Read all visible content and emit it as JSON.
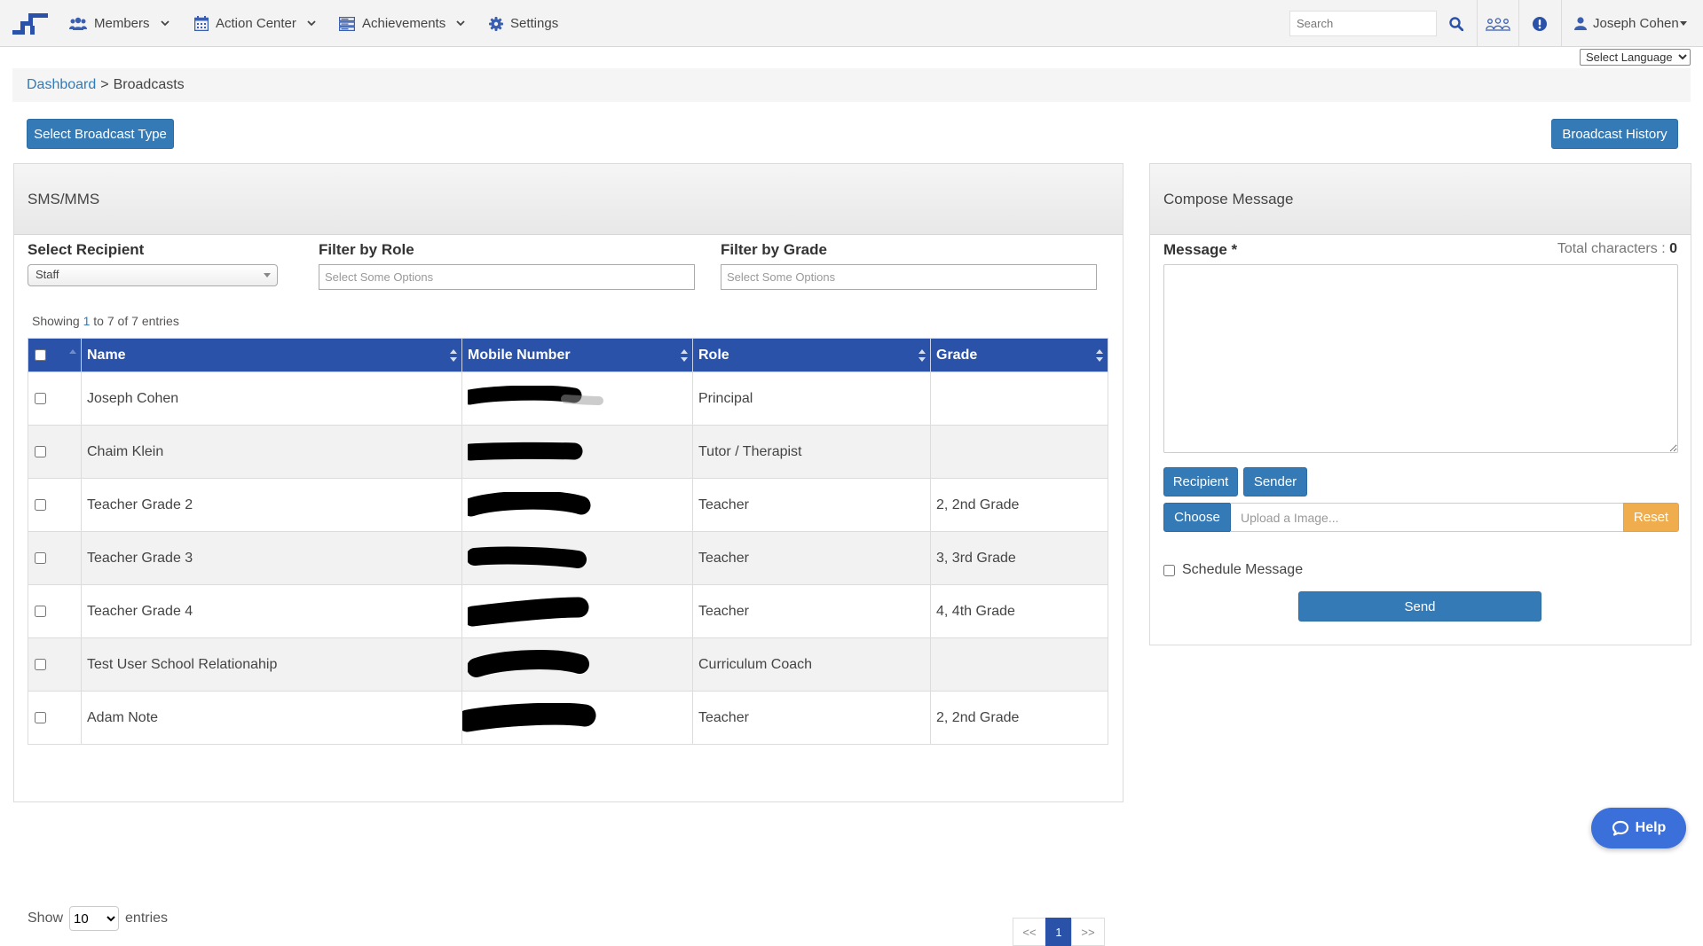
{
  "nav": {
    "items": [
      {
        "label": "Members",
        "icon": "users-icon",
        "has_dropdown": true
      },
      {
        "label": "Action Center",
        "icon": "calendar-icon",
        "has_dropdown": true
      },
      {
        "label": "Achievements",
        "icon": "server-icon",
        "has_dropdown": true
      },
      {
        "label": "Settings",
        "icon": "gear-icon",
        "has_dropdown": false
      }
    ],
    "search_placeholder": "Search",
    "user_name": "Joseph Cohen",
    "language_select": "Select Language"
  },
  "breadcrumb": {
    "home": "Dashboard",
    "separator": ">",
    "current": "Broadcasts"
  },
  "actions": {
    "select_type": "Select Broadcast Type",
    "history": "Broadcast History"
  },
  "sms_panel": {
    "title": "SMS/MMS",
    "select_recipient_label": "Select Recipient",
    "select_recipient_value": "Staff",
    "filter_role_label": "Filter by Role",
    "filter_role_placeholder": "Select Some Options",
    "filter_grade_label": "Filter by Grade",
    "filter_grade_placeholder": "Select Some Options",
    "showing": {
      "prefix": "Showing",
      "from": "1",
      "to_word": "to",
      "to": "7",
      "of_word": "of",
      "total": "7",
      "suffix": "entries"
    },
    "columns": [
      "Name",
      "Mobile Number",
      "Role",
      "Grade"
    ],
    "rows": [
      {
        "name": "Joseph Cohen",
        "mobile": "[redacted]",
        "role": "Principal",
        "grade": ""
      },
      {
        "name": "Chaim Klein",
        "mobile": "[redacted]",
        "role": "Tutor / Therapist",
        "grade": ""
      },
      {
        "name": "Teacher Grade 2",
        "mobile": "[redacted]",
        "role": "Teacher",
        "grade": "2, 2nd Grade"
      },
      {
        "name": "Teacher Grade 3",
        "mobile": "[redacted]",
        "role": "Teacher",
        "grade": "3, 3rd Grade"
      },
      {
        "name": "Teacher Grade 4",
        "mobile": "[redacted]",
        "role": "Teacher",
        "grade": "4, 4th Grade"
      },
      {
        "name": "Test User School Relationahip",
        "mobile": "[redacted]",
        "role": "Curriculum Coach",
        "grade": ""
      },
      {
        "name": "Adam Note",
        "mobile": "[redacted]",
        "role": "Teacher",
        "grade": "2, 2nd Grade"
      }
    ],
    "show_label": "Show",
    "entries_value": "10",
    "entries_label": "entries",
    "pager": {
      "prev": "<<",
      "current": "1",
      "next": ">>"
    }
  },
  "compose": {
    "title": "Compose Message",
    "message_label": "Message *",
    "char_count_label": "Total characters :",
    "char_count": "0",
    "recipient_button": "Recipient",
    "sender_button": "Sender",
    "choose_button": "Choose",
    "upload_placeholder": "Upload a Image...",
    "reset_button": "Reset",
    "schedule_label": "Schedule Message",
    "send_button": "Send"
  },
  "help": {
    "label": "Help"
  },
  "colors": {
    "primary": "#337ab7",
    "table_header": "#2a52a8",
    "warning": "#f0ad4e",
    "help": "#3b6fd9"
  }
}
